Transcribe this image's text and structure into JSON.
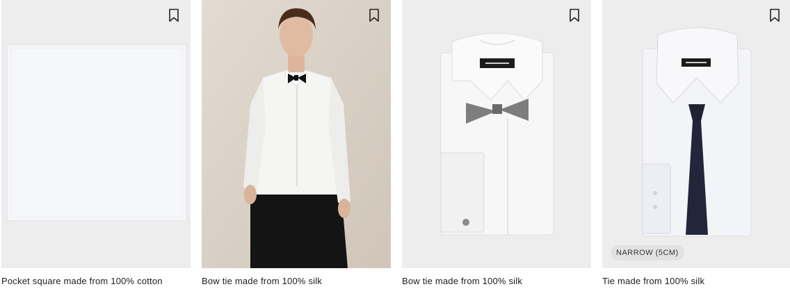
{
  "products": [
    {
      "title": "Pocket square made from 100% cotton",
      "bookmark_icon": "bookmark-icon",
      "badge": ""
    },
    {
      "title": "Bow tie made from 100% silk",
      "bookmark_icon": "bookmark-icon",
      "badge": ""
    },
    {
      "title": "Bow tie made from 100% silk",
      "bookmark_icon": "bookmark-icon",
      "badge": ""
    },
    {
      "title": "Tie made from 100% silk",
      "bookmark_icon": "bookmark-icon",
      "badge": "NARROW (5CM)"
    }
  ],
  "colors": {
    "image_background": "#ededed",
    "model_background": "#d8cfc4",
    "badge_background": "#e2e2e2",
    "text": "#1d1d1d"
  }
}
